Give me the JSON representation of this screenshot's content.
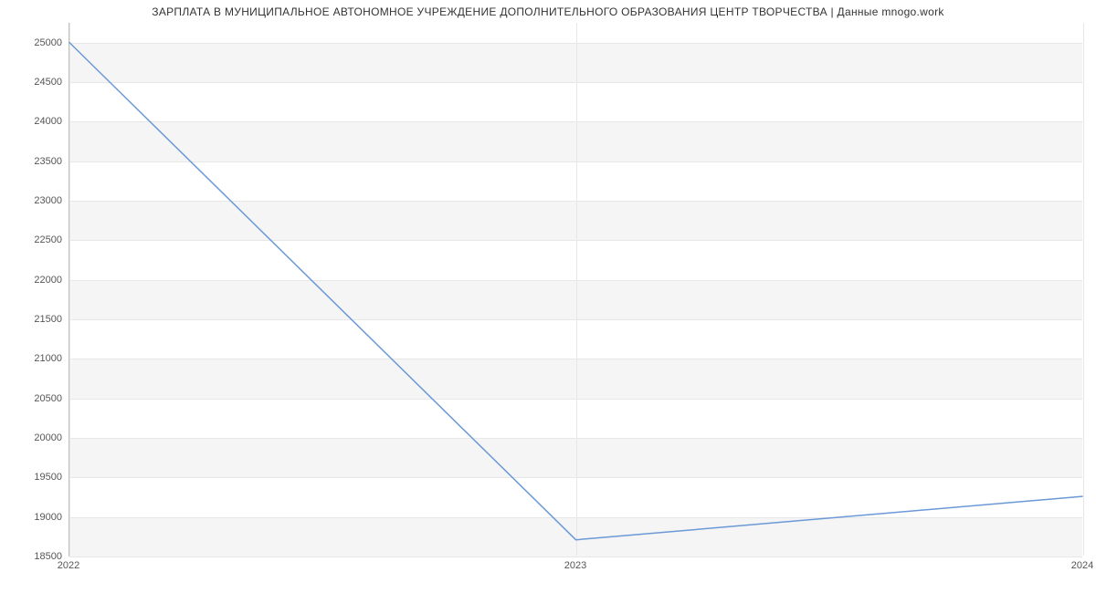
{
  "chart_data": {
    "type": "line",
    "title": "ЗАРПЛАТА В МУНИЦИПАЛЬНОЕ АВТОНОМНОЕ УЧРЕЖДЕНИЕ ДОПОЛНИТЕЛЬНОГО ОБРАЗОВАНИЯ ЦЕНТР ТВОРЧЕСТВА | Данные mnogo.work",
    "xlabel": "",
    "ylabel": "",
    "x_categories": [
      "2022",
      "2023",
      "2024"
    ],
    "x_numeric": [
      2022,
      2023,
      2024
    ],
    "y_ticks": [
      18500,
      19000,
      19500,
      20000,
      20500,
      21000,
      21500,
      22000,
      22500,
      23000,
      23500,
      24000,
      24500,
      25000
    ],
    "ylim": [
      18500,
      25250
    ],
    "xlim": [
      2022,
      2024
    ],
    "series": [
      {
        "name": "Зарплата",
        "x": [
          2022,
          2023,
          2024
        ],
        "y": [
          25000,
          18700,
          19250
        ]
      }
    ],
    "grid": true,
    "legend": false,
    "line_color": "#6b99d6"
  }
}
